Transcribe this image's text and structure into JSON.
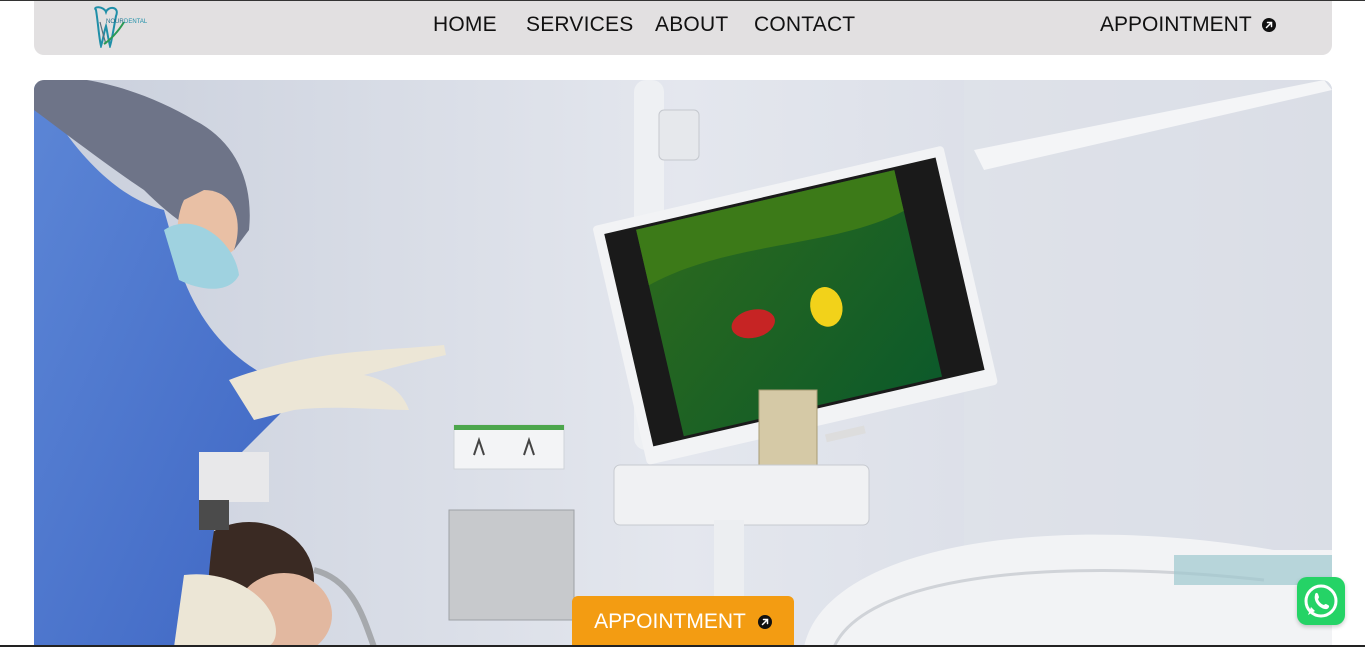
{
  "nav": {
    "home": "HOME",
    "services": "SERVICES",
    "about": "ABOUT",
    "contact": "CONTACT",
    "appointment": "APPOINTMENT"
  },
  "logo": {
    "text": "NOUR DENTAL",
    "icon": "tooth-logo-icon"
  },
  "hero": {
    "image": "dentist-pointing-at-monitor-photo",
    "cta_label": "APPOINTMENT",
    "cta_icon": "arrow-up-right-icon"
  },
  "floating": {
    "whatsapp_icon": "whatsapp-icon"
  },
  "colors": {
    "navbar_bg": "#e2e0e1",
    "accent": "#f39c12",
    "whatsapp": "#25d366",
    "text": "#111111"
  }
}
